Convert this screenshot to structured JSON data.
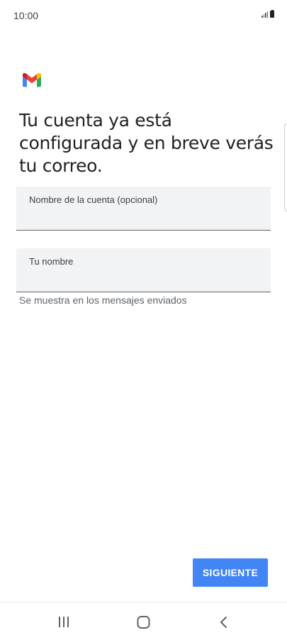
{
  "status_bar": {
    "time": "10:00",
    "icons": [
      "signal-icon",
      "battery-icon"
    ]
  },
  "app": {
    "logo": "gmail-logo-icon",
    "colors": {
      "red": "#EA4335",
      "blue": "#4285F4",
      "green": "#34A853",
      "yellow": "#FBBC05"
    }
  },
  "content": {
    "headline": "Tu cuenta ya está configurada y en breve verás tu correo.",
    "account_name_field": {
      "label": "Nombre de la cuenta (opcional)",
      "value": ""
    },
    "your_name_field": {
      "label": "Tu nombre",
      "value": ""
    },
    "helper_text": "Se muestra en los mensajes enviados"
  },
  "actions": {
    "next_label": "SIGUIENTE",
    "accent_color": "#4285F4"
  },
  "nav_bar": {
    "icons": [
      "recent-apps-icon",
      "home-icon",
      "back-icon"
    ]
  }
}
